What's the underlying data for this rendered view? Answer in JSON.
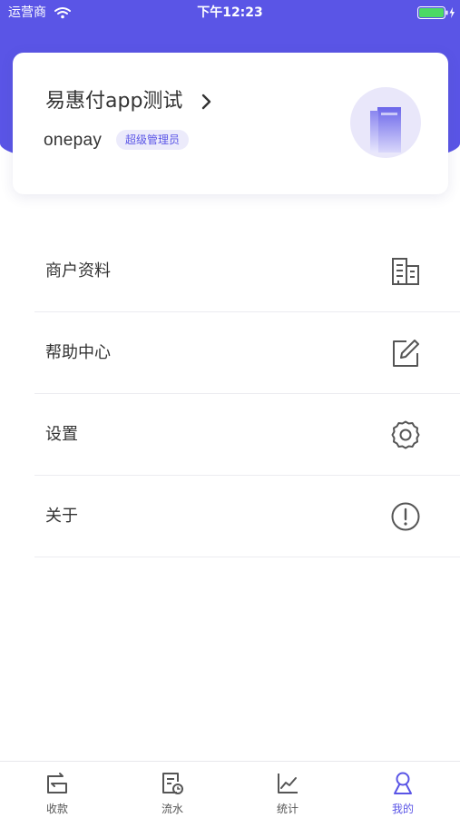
{
  "status_bar": {
    "carrier": "运营商",
    "time": "下午12:23"
  },
  "profile": {
    "merchant_name": "易惠付app测试",
    "username": "onepay",
    "role": "超级管理员"
  },
  "menu": {
    "items": [
      {
        "label": "商户资料",
        "icon": "building-icon"
      },
      {
        "label": "帮助中心",
        "icon": "edit-icon"
      },
      {
        "label": "设置",
        "icon": "gear-icon"
      },
      {
        "label": "关于",
        "icon": "info-icon"
      }
    ]
  },
  "tabs": [
    {
      "label": "收款",
      "icon": "receive-icon",
      "active": false
    },
    {
      "label": "流水",
      "icon": "statement-icon",
      "active": false
    },
    {
      "label": "统计",
      "icon": "chart-icon",
      "active": false
    },
    {
      "label": "我的",
      "icon": "profile-icon",
      "active": true
    }
  ],
  "colors": {
    "accent": "#5a55e6",
    "icon_gray": "#555555",
    "battery": "#4cd964"
  }
}
